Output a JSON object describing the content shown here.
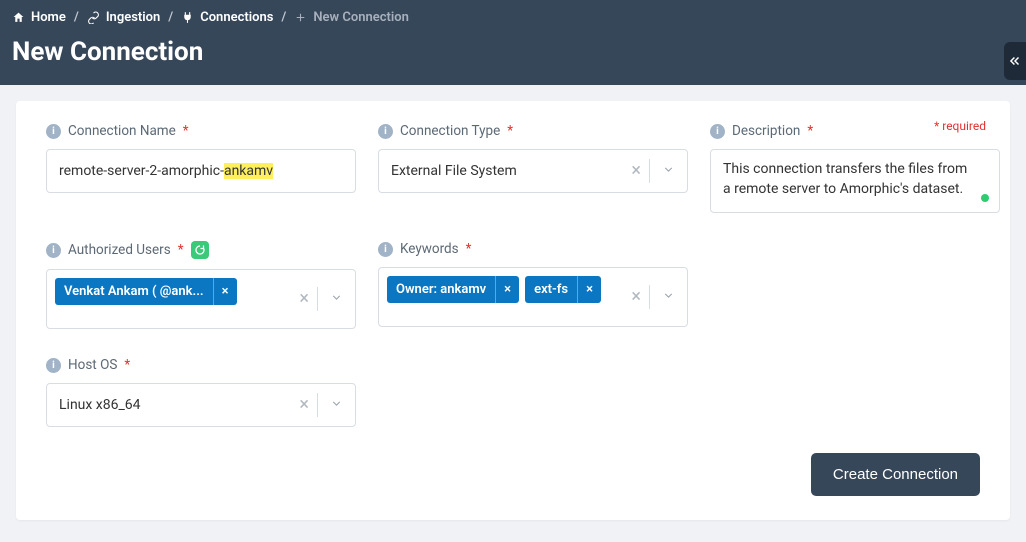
{
  "breadcrumb": {
    "home": "Home",
    "ingestion": "Ingestion",
    "connections": "Connections",
    "current": "New Connection"
  },
  "page_title": "New Connection",
  "required_note": "* required",
  "labels": {
    "connection_name": "Connection Name",
    "connection_type": "Connection Type",
    "description": "Description",
    "authorized_users": "Authorized Users",
    "keywords": "Keywords",
    "host_os": "Host OS"
  },
  "values": {
    "connection_name_prefix": "remote-server-2-amorphic-",
    "connection_name_highlight": "ankamv",
    "connection_type": "External File System",
    "description": "This connection transfers the files from a remote server to Amorphic's dataset.",
    "host_os": "Linux x86_64"
  },
  "authorized_users": [
    {
      "label": "Venkat Ankam ( @ank..."
    }
  ],
  "keywords": [
    {
      "label": "Owner: ankamv"
    },
    {
      "label": "ext-fs"
    }
  ],
  "buttons": {
    "create": "Create Connection"
  },
  "icons": {
    "clear": "×",
    "chip_remove": "×"
  }
}
